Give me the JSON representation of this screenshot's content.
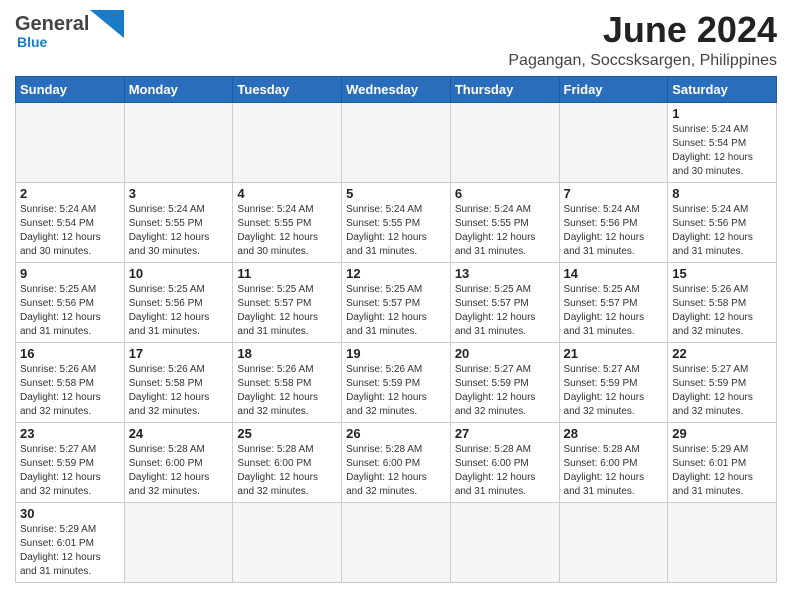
{
  "header": {
    "logo_general": "General",
    "logo_blue": "Blue",
    "title": "June 2024",
    "subtitle": "Pagangan, Soccsksargen, Philippines"
  },
  "days_of_week": [
    "Sunday",
    "Monday",
    "Tuesday",
    "Wednesday",
    "Thursday",
    "Friday",
    "Saturday"
  ],
  "weeks": [
    [
      {
        "day": "",
        "info": ""
      },
      {
        "day": "",
        "info": ""
      },
      {
        "day": "",
        "info": ""
      },
      {
        "day": "",
        "info": ""
      },
      {
        "day": "",
        "info": ""
      },
      {
        "day": "",
        "info": ""
      },
      {
        "day": "1",
        "info": "Sunrise: 5:24 AM\nSunset: 5:54 PM\nDaylight: 12 hours\nand 30 minutes."
      }
    ],
    [
      {
        "day": "2",
        "info": "Sunrise: 5:24 AM\nSunset: 5:54 PM\nDaylight: 12 hours\nand 30 minutes."
      },
      {
        "day": "3",
        "info": "Sunrise: 5:24 AM\nSunset: 5:55 PM\nDaylight: 12 hours\nand 30 minutes."
      },
      {
        "day": "4",
        "info": "Sunrise: 5:24 AM\nSunset: 5:55 PM\nDaylight: 12 hours\nand 30 minutes."
      },
      {
        "day": "5",
        "info": "Sunrise: 5:24 AM\nSunset: 5:55 PM\nDaylight: 12 hours\nand 31 minutes."
      },
      {
        "day": "6",
        "info": "Sunrise: 5:24 AM\nSunset: 5:55 PM\nDaylight: 12 hours\nand 31 minutes."
      },
      {
        "day": "7",
        "info": "Sunrise: 5:24 AM\nSunset: 5:56 PM\nDaylight: 12 hours\nand 31 minutes."
      },
      {
        "day": "8",
        "info": "Sunrise: 5:24 AM\nSunset: 5:56 PM\nDaylight: 12 hours\nand 31 minutes."
      }
    ],
    [
      {
        "day": "9",
        "info": "Sunrise: 5:25 AM\nSunset: 5:56 PM\nDaylight: 12 hours\nand 31 minutes."
      },
      {
        "day": "10",
        "info": "Sunrise: 5:25 AM\nSunset: 5:56 PM\nDaylight: 12 hours\nand 31 minutes."
      },
      {
        "day": "11",
        "info": "Sunrise: 5:25 AM\nSunset: 5:57 PM\nDaylight: 12 hours\nand 31 minutes."
      },
      {
        "day": "12",
        "info": "Sunrise: 5:25 AM\nSunset: 5:57 PM\nDaylight: 12 hours\nand 31 minutes."
      },
      {
        "day": "13",
        "info": "Sunrise: 5:25 AM\nSunset: 5:57 PM\nDaylight: 12 hours\nand 31 minutes."
      },
      {
        "day": "14",
        "info": "Sunrise: 5:25 AM\nSunset: 5:57 PM\nDaylight: 12 hours\nand 31 minutes."
      },
      {
        "day": "15",
        "info": "Sunrise: 5:26 AM\nSunset: 5:58 PM\nDaylight: 12 hours\nand 32 minutes."
      }
    ],
    [
      {
        "day": "16",
        "info": "Sunrise: 5:26 AM\nSunset: 5:58 PM\nDaylight: 12 hours\nand 32 minutes."
      },
      {
        "day": "17",
        "info": "Sunrise: 5:26 AM\nSunset: 5:58 PM\nDaylight: 12 hours\nand 32 minutes."
      },
      {
        "day": "18",
        "info": "Sunrise: 5:26 AM\nSunset: 5:58 PM\nDaylight: 12 hours\nand 32 minutes."
      },
      {
        "day": "19",
        "info": "Sunrise: 5:26 AM\nSunset: 5:59 PM\nDaylight: 12 hours\nand 32 minutes."
      },
      {
        "day": "20",
        "info": "Sunrise: 5:27 AM\nSunset: 5:59 PM\nDaylight: 12 hours\nand 32 minutes."
      },
      {
        "day": "21",
        "info": "Sunrise: 5:27 AM\nSunset: 5:59 PM\nDaylight: 12 hours\nand 32 minutes."
      },
      {
        "day": "22",
        "info": "Sunrise: 5:27 AM\nSunset: 5:59 PM\nDaylight: 12 hours\nand 32 minutes."
      }
    ],
    [
      {
        "day": "23",
        "info": "Sunrise: 5:27 AM\nSunset: 5:59 PM\nDaylight: 12 hours\nand 32 minutes."
      },
      {
        "day": "24",
        "info": "Sunrise: 5:28 AM\nSunset: 6:00 PM\nDaylight: 12 hours\nand 32 minutes."
      },
      {
        "day": "25",
        "info": "Sunrise: 5:28 AM\nSunset: 6:00 PM\nDaylight: 12 hours\nand 32 minutes."
      },
      {
        "day": "26",
        "info": "Sunrise: 5:28 AM\nSunset: 6:00 PM\nDaylight: 12 hours\nand 32 minutes."
      },
      {
        "day": "27",
        "info": "Sunrise: 5:28 AM\nSunset: 6:00 PM\nDaylight: 12 hours\nand 31 minutes."
      },
      {
        "day": "28",
        "info": "Sunrise: 5:28 AM\nSunset: 6:00 PM\nDaylight: 12 hours\nand 31 minutes."
      },
      {
        "day": "29",
        "info": "Sunrise: 5:29 AM\nSunset: 6:01 PM\nDaylight: 12 hours\nand 31 minutes."
      }
    ],
    [
      {
        "day": "30",
        "info": "Sunrise: 5:29 AM\nSunset: 6:01 PM\nDaylight: 12 hours\nand 31 minutes."
      },
      {
        "day": "",
        "info": ""
      },
      {
        "day": "",
        "info": ""
      },
      {
        "day": "",
        "info": ""
      },
      {
        "day": "",
        "info": ""
      },
      {
        "day": "",
        "info": ""
      },
      {
        "day": "",
        "info": ""
      }
    ]
  ]
}
